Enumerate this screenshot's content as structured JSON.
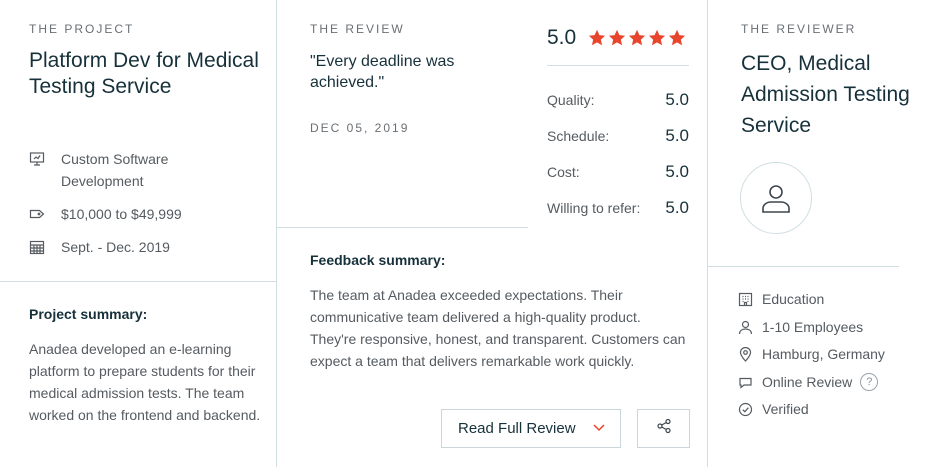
{
  "project": {
    "eyebrow": "THE PROJECT",
    "title": "Platform Dev for Medical Testing Service",
    "service": "Custom Software Development",
    "budget": "$10,000 to $49,999",
    "dates": "Sept. - Dec. 2019",
    "summary_heading": "Project summary:",
    "summary": "Anadea developed an e-learning platform to prepare students for their medical admission tests. The team worked on the frontend and backend."
  },
  "review": {
    "eyebrow": "THE REVIEW",
    "quote": "\"Every deadline was achieved.\"",
    "date": "DEC 05, 2019",
    "overall": "5.0",
    "star_count": 5,
    "star_color": "#e8452c",
    "scores": [
      {
        "label": "Quality:",
        "value": "5.0"
      },
      {
        "label": "Schedule:",
        "value": "5.0"
      },
      {
        "label": "Cost:",
        "value": "5.0"
      },
      {
        "label": "Willing to refer:",
        "value": "5.0"
      }
    ],
    "feedback_heading": "Feedback summary:",
    "feedback": "The team at Anadea exceeded expectations. Their communicative team delivered a high-quality product. They're responsive, honest, and transparent. Customers can expect a team that delivers remarkable work quickly.",
    "read_button": "Read Full Review",
    "icons": {
      "read": "chevron-down-icon",
      "share": "share-icon"
    }
  },
  "reviewer": {
    "eyebrow": "THE REVIEWER",
    "title": "CEO, Medical Admission Testing Service",
    "industry": "Education",
    "size": "1-10 Employees",
    "location": "Hamburg, Germany",
    "review_type": "Online Review",
    "help": "?",
    "status": "Verified"
  },
  "colors": {
    "accent": "#e8452c",
    "divider": "#d1dfe3",
    "heading": "#17313b"
  }
}
